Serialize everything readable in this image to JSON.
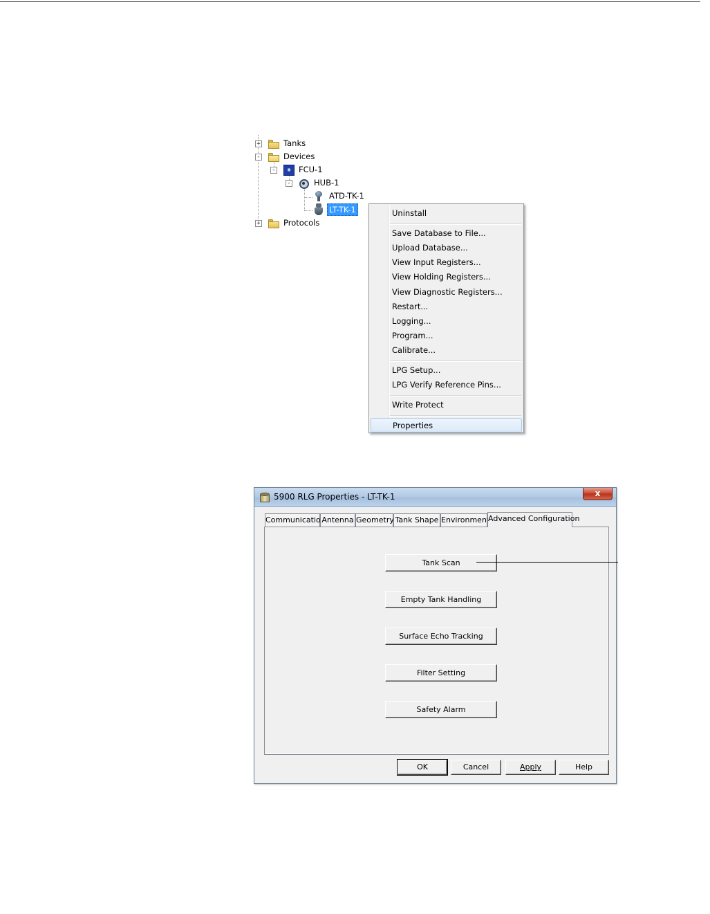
{
  "tree": {
    "nodes": [
      {
        "label": "Tanks",
        "icon": "folder-icon",
        "expander": "+"
      },
      {
        "label": "Devices",
        "icon": "folder-open-icon",
        "expander": "-"
      },
      {
        "label": "FCU-1",
        "icon": "fcu-chip-icon",
        "expander": "-"
      },
      {
        "label": "HUB-1",
        "icon": "hub-icon",
        "expander": "-"
      },
      {
        "label": "ATD-TK-1",
        "icon": "temperature-gauge-icon"
      },
      {
        "label": "LT-TK-1",
        "icon": "radar-gauge-icon",
        "selected": true
      },
      {
        "label": "Protocols",
        "icon": "folder-icon",
        "expander": "+"
      }
    ]
  },
  "context_menu": {
    "items": [
      "Uninstall",
      "Save Database to File...",
      "Upload Database...",
      "View Input Registers...",
      "View Holding Registers...",
      "View Diagnostic Registers...",
      "Restart...",
      "Logging...",
      "Program...",
      "Calibrate...",
      "LPG Setup...",
      "LPG Verify Reference Pins...",
      "Write Protect",
      "Properties"
    ],
    "hovered": "Properties"
  },
  "dialog": {
    "title": "5900 RLG Properties - LT-TK-1",
    "close_label": "x",
    "tabs": [
      "Communication",
      "Antenna",
      "Geometry",
      "Tank Shape",
      "Environment",
      "Advanced Configuration"
    ],
    "active_tab": "Advanced Configuration",
    "config_buttons": [
      "Tank Scan",
      "Empty Tank Handling",
      "Surface Echo Tracking",
      "Filter Setting",
      "Safety Alarm"
    ],
    "footer_buttons": {
      "ok": "OK",
      "cancel": "Cancel",
      "apply": "Apply",
      "help": "Help"
    }
  }
}
